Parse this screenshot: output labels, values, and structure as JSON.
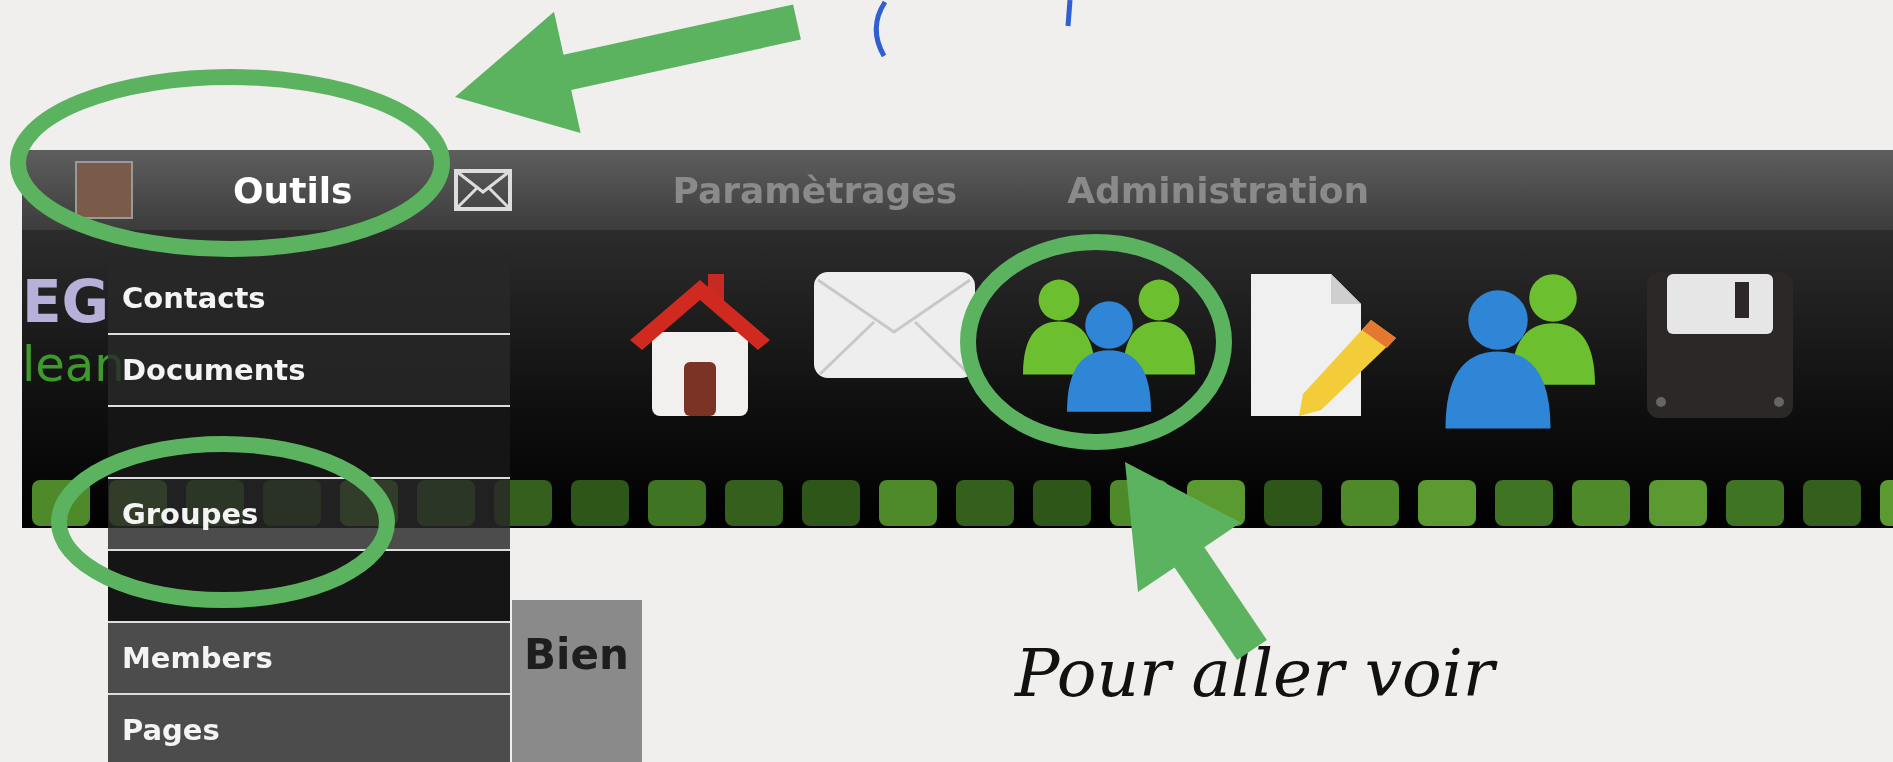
{
  "menu_bar": {
    "items": [
      {
        "kind": "avatar"
      },
      {
        "kind": "text",
        "label": "Outils",
        "active": true
      },
      {
        "kind": "mail"
      },
      {
        "kind": "text",
        "label": "Paramètrages",
        "active": false
      },
      {
        "kind": "text",
        "label": "Administration",
        "active": false
      }
    ]
  },
  "logo": {
    "line_1": "EG",
    "line_2": "lean"
  },
  "toolbar": {
    "icons": [
      {
        "kind": "home"
      },
      {
        "kind": "mail"
      },
      {
        "kind": "group"
      },
      {
        "kind": "edit-document"
      },
      {
        "kind": "users"
      },
      {
        "kind": "floppy"
      }
    ]
  },
  "panel": {
    "heading": "Bien"
  },
  "dropdown": {
    "items": [
      {
        "label": "Contacts",
        "obscured": false
      },
      {
        "label": "Documents",
        "obscured": false
      },
      {
        "obscured": true
      },
      {
        "label": "Groupes",
        "obscured": false
      },
      {
        "obscured": true
      },
      {
        "label": "Members",
        "obscured": false
      },
      {
        "label": "Pages",
        "obscured": false
      }
    ]
  },
  "annotation": {
    "caption": "Pour aller voir"
  }
}
